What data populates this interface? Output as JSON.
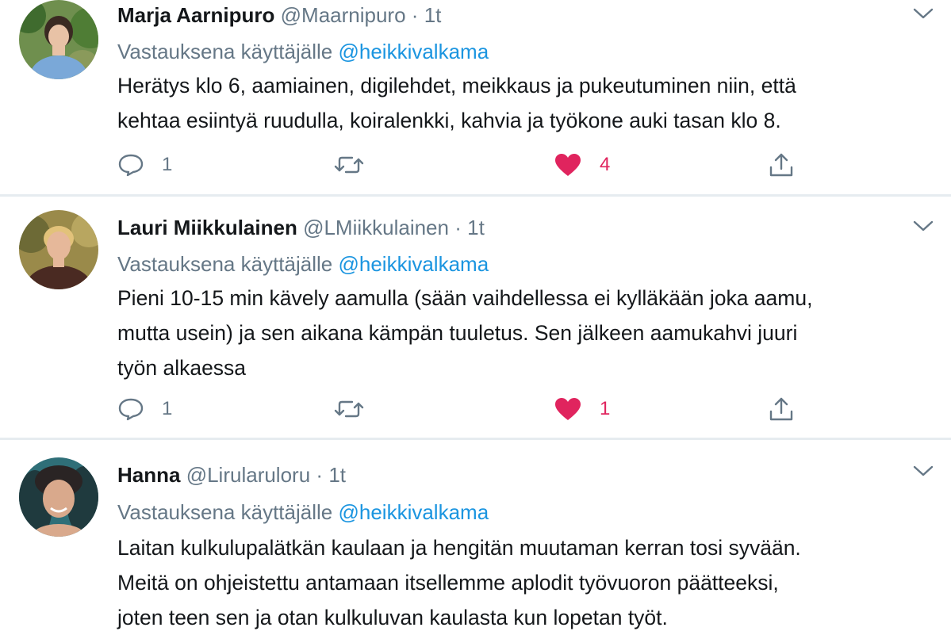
{
  "colors": {
    "text": "#14171a",
    "secondary": "#657786",
    "link": "#1b95e0",
    "like": "#e0245e",
    "divider": "#e6ecf0"
  },
  "icons": {
    "reply": "speech-bubble-outline",
    "retweet": "two-arrows-loop",
    "like": "heart-filled",
    "share": "upload-arrow",
    "menu": "chevron-down"
  },
  "tweets": [
    {
      "name": "Marja Aarnipuro",
      "handle": "@Maarnipuro",
      "separator": "·",
      "time": "1t",
      "replying_label": "Vastauksena käyttäjälle",
      "replying_to": "@heikkivalkama",
      "lines": [
        "Herätys klo 6, aamiainen, digilehdet, meikkaus ja pukeutuminen niin, että",
        "kehtaa esiintyä ruudulla, koiralenkki, kahvia ja työkone auki tasan klo 8."
      ],
      "replies": "1",
      "likes": "4"
    },
    {
      "name": "Lauri Miikkulainen",
      "handle": "@LMiikkulainen",
      "separator": "·",
      "time": "1t",
      "replying_label": "Vastauksena käyttäjälle",
      "replying_to": "@heikkivalkama",
      "lines": [
        "Pieni 10-15 min kävely aamulla (sään vaihdellessa ei kylläkään joka aamu,",
        "mutta usein) ja sen aikana kämpän tuuletus. Sen jälkeen aamukahvi juuri",
        "työn alkaessa"
      ],
      "replies": "1",
      "likes": "1"
    },
    {
      "name": "Hanna",
      "handle": "@Lirularuloru",
      "separator": "·",
      "time": "1t",
      "replying_label": "Vastauksena käyttäjälle",
      "replying_to": "@heikkivalkama",
      "lines": [
        "Laitan kulkulupalätkän kaulaan ja hengitän muutaman kerran tosi syvään.",
        "Meitä on ohjeistettu antamaan itsellemme aplodit työvuoron päätteeksi,",
        "joten teen sen ja otan kulkuluvan kaulasta kun lopetan työt."
      ]
    }
  ]
}
